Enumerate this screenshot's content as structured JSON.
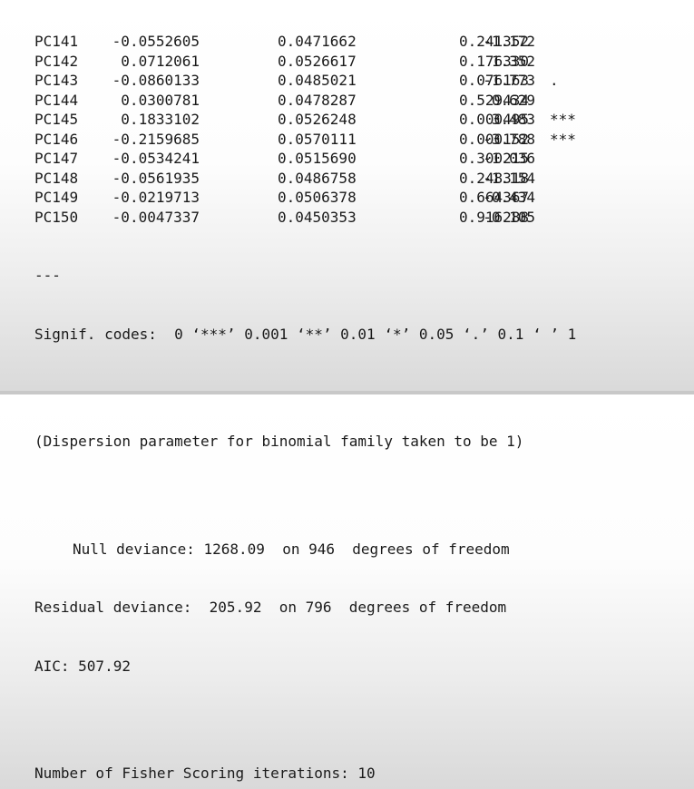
{
  "coefficients": [
    {
      "name": "PC141",
      "estimate": "-0.0552605",
      "std_error": "0.0471662",
      "z": "-1.172",
      "p": "0.241352",
      "signif": ""
    },
    {
      "name": "PC142",
      "estimate": "0.0712061",
      "std_error": "0.0526617",
      "z": "1.352",
      "p": "0.176330",
      "signif": ""
    },
    {
      "name": "PC143",
      "estimate": "-0.0860133",
      "std_error": "0.0485021",
      "z": "-1.773",
      "p": "0.076163",
      "signif": "."
    },
    {
      "name": "PC144",
      "estimate": "0.0300781",
      "std_error": "0.0478287",
      "z": "0.629",
      "p": "0.529434",
      "signif": ""
    },
    {
      "name": "PC145",
      "estimate": "0.1833102",
      "std_error": "0.0526248",
      "z": "3.483",
      "p": "0.000495",
      "signif": "***"
    },
    {
      "name": "PC146",
      "estimate": "-0.2159685",
      "std_error": "0.0570111",
      "z": "-3.788",
      "p": "0.000152",
      "signif": "***"
    },
    {
      "name": "PC147",
      "estimate": "-0.0534241",
      "std_error": "0.0515690",
      "z": "-1.036",
      "p": "0.300215",
      "signif": ""
    },
    {
      "name": "PC148",
      "estimate": "-0.0561935",
      "std_error": "0.0486758",
      "z": "-1.154",
      "p": "0.248318",
      "signif": ""
    },
    {
      "name": "PC149",
      "estimate": "-0.0219713",
      "std_error": "0.0506378",
      "z": "-0.434",
      "p": "0.664367",
      "signif": ""
    },
    {
      "name": "PC150",
      "estimate": "-0.0047337",
      "std_error": "0.0450353",
      "z": "-0.105",
      "p": "0.916288",
      "signif": ""
    }
  ],
  "separator": "---",
  "signif_codes": "Signif. codes:  0 ‘***’ 0.001 ‘**’ 0.01 ‘*’ 0.05 ‘.’ 0.1 ‘ ’ 1",
  "dispersion": "(Dispersion parameter for binomial family taken to be 1)",
  "null_deviance": "Null deviance: 1268.09  on 946  degrees of freedom",
  "residual_deviance": "Residual deviance:  205.92  on 796  degrees of freedom",
  "aic": "AIC: 507.92",
  "fisher_iterations": "Number of Fisher Scoring iterations: 10"
}
